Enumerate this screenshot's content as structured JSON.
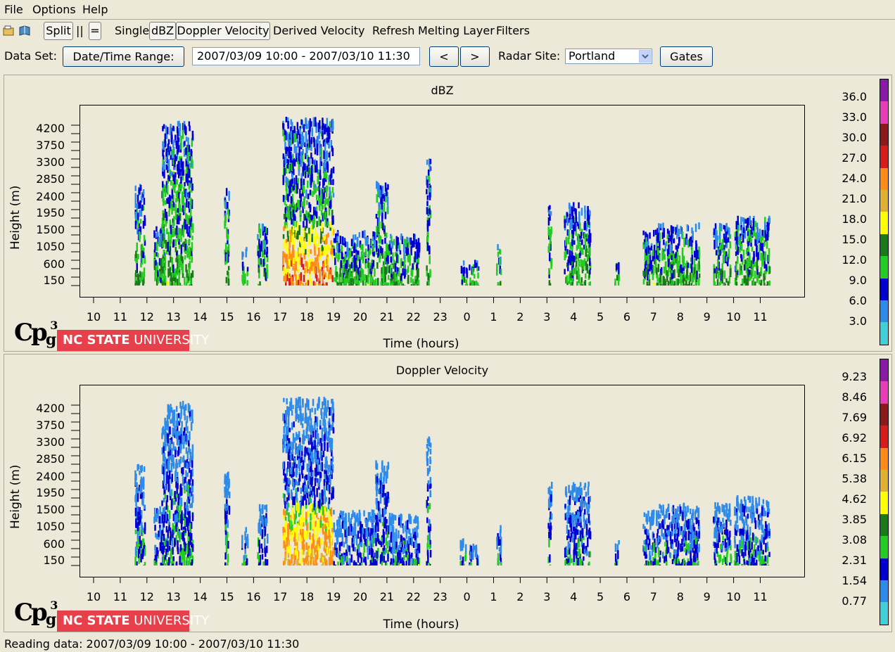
{
  "menu": {
    "file": "File",
    "options": "Options",
    "help": "Help"
  },
  "toolbar": {
    "split": "Split",
    "columns": "||",
    "rows": "=",
    "single": "Single",
    "dbz": "dBZ",
    "doppler": "Doppler Velocity",
    "derived": "Derived Velocity",
    "refresh": "Refresh",
    "melting": "Melting Layer",
    "filters": "Filters"
  },
  "dataset": {
    "label": "Data Set:",
    "date_button": "Date/Time Range:",
    "range_value": "2007/03/09 10:00 - 2007/03/10 11:30",
    "prev": "<",
    "next": ">",
    "radar_label": "Radar Site:",
    "radar_value": "Portland",
    "gates": "Gates"
  },
  "logo": {
    "cp": "Cp",
    "sub_g": "g",
    "sup_3": "3",
    "nc": "NC STATE UNIVERSITY",
    "nc_bold": "NC STATE",
    "nc_light": " UNIVERSITY"
  },
  "status": "Reading data: 2007/03/09 10:00 - 2007/03/10 11:30",
  "colors": {
    "colorbar": [
      "#8a1aa8",
      "#e93cb8",
      "#8b1a1a",
      "#d81c1c",
      "#ff8c1a",
      "#e0b030",
      "#ffff00",
      "#1a7a1a",
      "#22cc22",
      "#0000d0",
      "#2e8bea",
      "#40d0d8"
    ]
  },
  "chart_data": [
    {
      "type": "heatmap",
      "title": "dBZ",
      "xlabel": "Time (hours)",
      "ylabel": "Height (m)",
      "x_ticks": [
        "10",
        "11",
        "12",
        "13",
        "14",
        "15",
        "16",
        "17",
        "18",
        "19",
        "20",
        "21",
        "22",
        "23",
        "0",
        "1",
        "2",
        "3",
        "4",
        "5",
        "6",
        "7",
        "8",
        "9",
        "10",
        "11"
      ],
      "y_ticks": [
        "150",
        "600",
        "1050",
        "1500",
        "1950",
        "2400",
        "2850",
        "3300",
        "3750",
        "4200"
      ],
      "colorbar_ticks": [
        "36.0",
        "33.0",
        "30.0",
        "27.0",
        "24.0",
        "21.0",
        "18.0",
        "15.0",
        "12.0",
        "9.0",
        "6.0",
        "3.0"
      ]
    },
    {
      "type": "heatmap",
      "title": "Doppler Velocity",
      "xlabel": "Time (hours)",
      "ylabel": "Height (m)",
      "x_ticks": [
        "10",
        "11",
        "12",
        "13",
        "14",
        "15",
        "16",
        "17",
        "18",
        "19",
        "20",
        "21",
        "22",
        "23",
        "0",
        "1",
        "2",
        "3",
        "4",
        "5",
        "6",
        "7",
        "8",
        "9",
        "10",
        "11"
      ],
      "y_ticks": [
        "150",
        "600",
        "1050",
        "1500",
        "1950",
        "2400",
        "2850",
        "3300",
        "3750",
        "4200"
      ],
      "colorbar_ticks": [
        "9.23",
        "8.46",
        "7.69",
        "6.92",
        "6.15",
        "5.38",
        "4.62",
        "3.85",
        "3.08",
        "2.31",
        "1.54",
        "0.77"
      ]
    }
  ]
}
